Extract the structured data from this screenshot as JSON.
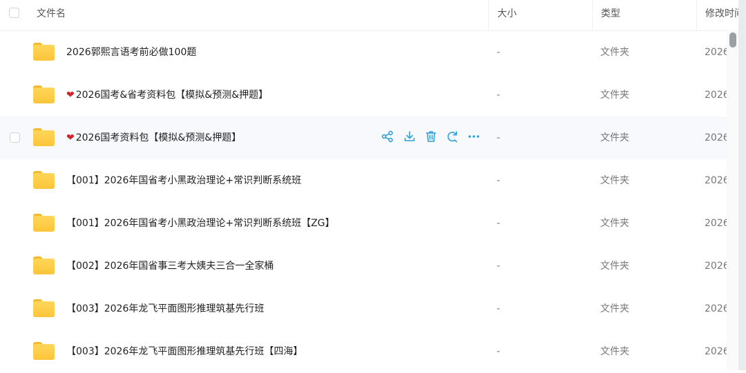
{
  "header": {
    "name": "文件名",
    "size": "大小",
    "type": "类型",
    "modified": "修改时间"
  },
  "rows": [
    {
      "name": "2026郭熙言语考前必做100题",
      "heart": "",
      "size": "-",
      "type": "文件夹",
      "date": "2026"
    },
    {
      "name": "2026国考&省考资料包【模拟&预测&押题】",
      "heart": "❤",
      "size": "-",
      "type": "文件夹",
      "date": "2026"
    },
    {
      "name": "2026国考资料包【模拟&预测&押题】",
      "heart": "❤",
      "size": "-",
      "type": "文件夹",
      "date": "2026"
    },
    {
      "name": "【001】2026年国省考小黑政治理论+常识判断系统班",
      "heart": "",
      "size": "-",
      "type": "文件夹",
      "date": "2026"
    },
    {
      "name": "【001】2026年国省考小黑政治理论+常识判断系统班【ZG】",
      "heart": "",
      "size": "-",
      "type": "文件夹",
      "date": "2026"
    },
    {
      "name": "【002】2026年国省事三考大姨夫三合一全家桶",
      "heart": "",
      "size": "-",
      "type": "文件夹",
      "date": "2026"
    },
    {
      "name": "【003】2026年龙飞平面图形推理筑基先行班",
      "heart": "",
      "size": "-",
      "type": "文件夹",
      "date": "2026"
    },
    {
      "name": "【003】2026年龙飞平面图形推理筑基先行班【四海】",
      "heart": "",
      "size": "-",
      "type": "文件夹",
      "date": "2026"
    }
  ],
  "hover_row_index": 2,
  "row_actions": [
    "share-icon",
    "download-icon",
    "delete-icon",
    "rename-icon",
    "more-icon"
  ],
  "colors": {
    "accent": "#2aa0d8",
    "folder": "#fcc53a",
    "heart": "#d0262b",
    "hover_bg": "#f7f9fc"
  }
}
